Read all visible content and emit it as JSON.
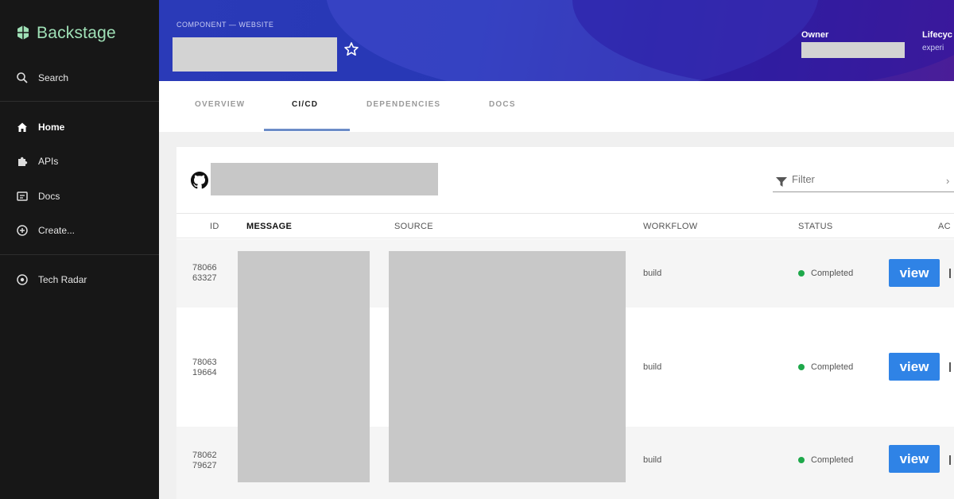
{
  "sidebar": {
    "logo_text": "Backstage",
    "search_label": "Search",
    "items": [
      {
        "label": "Home",
        "icon": "home-icon"
      },
      {
        "label": "APIs",
        "icon": "puzzle-icon"
      },
      {
        "label": "Docs",
        "icon": "docs-icon"
      },
      {
        "label": "Create...",
        "icon": "add-circle-icon"
      },
      {
        "label": "Tech Radar",
        "icon": "radar-icon"
      }
    ]
  },
  "header": {
    "breadcrumb": "COMPONENT — WEBSITE",
    "owner_label": "Owner",
    "lifecycle_label": "Lifecyc",
    "lifecycle_value": "experi"
  },
  "tabs": [
    {
      "label": "OVERVIEW"
    },
    {
      "label": "CI/CD"
    },
    {
      "label": "DEPENDENCIES"
    },
    {
      "label": "DOCS"
    }
  ],
  "filter": {
    "placeholder": "Filter"
  },
  "table": {
    "columns": [
      "ID",
      "MESSAGE",
      "SOURCE",
      "WORKFLOW",
      "STATUS",
      "AC"
    ],
    "rows": [
      {
        "id_line1": "78066",
        "id_line2": "63327",
        "workflow": "build",
        "status": "Completed",
        "action": "view"
      },
      {
        "id_line1": "78063",
        "id_line2": "19664",
        "workflow": "build",
        "status": "Completed",
        "action": "view"
      },
      {
        "id_line1": "78062",
        "id_line2": "79627",
        "workflow": "build",
        "status": "Completed",
        "action": "view"
      }
    ]
  },
  "colors": {
    "sidebar_bg": "#171717",
    "logo_green": "#9fe0b6",
    "header_blue": "#2a3ab8",
    "status_green": "#1ea84a",
    "button_blue": "#2f83e6"
  }
}
